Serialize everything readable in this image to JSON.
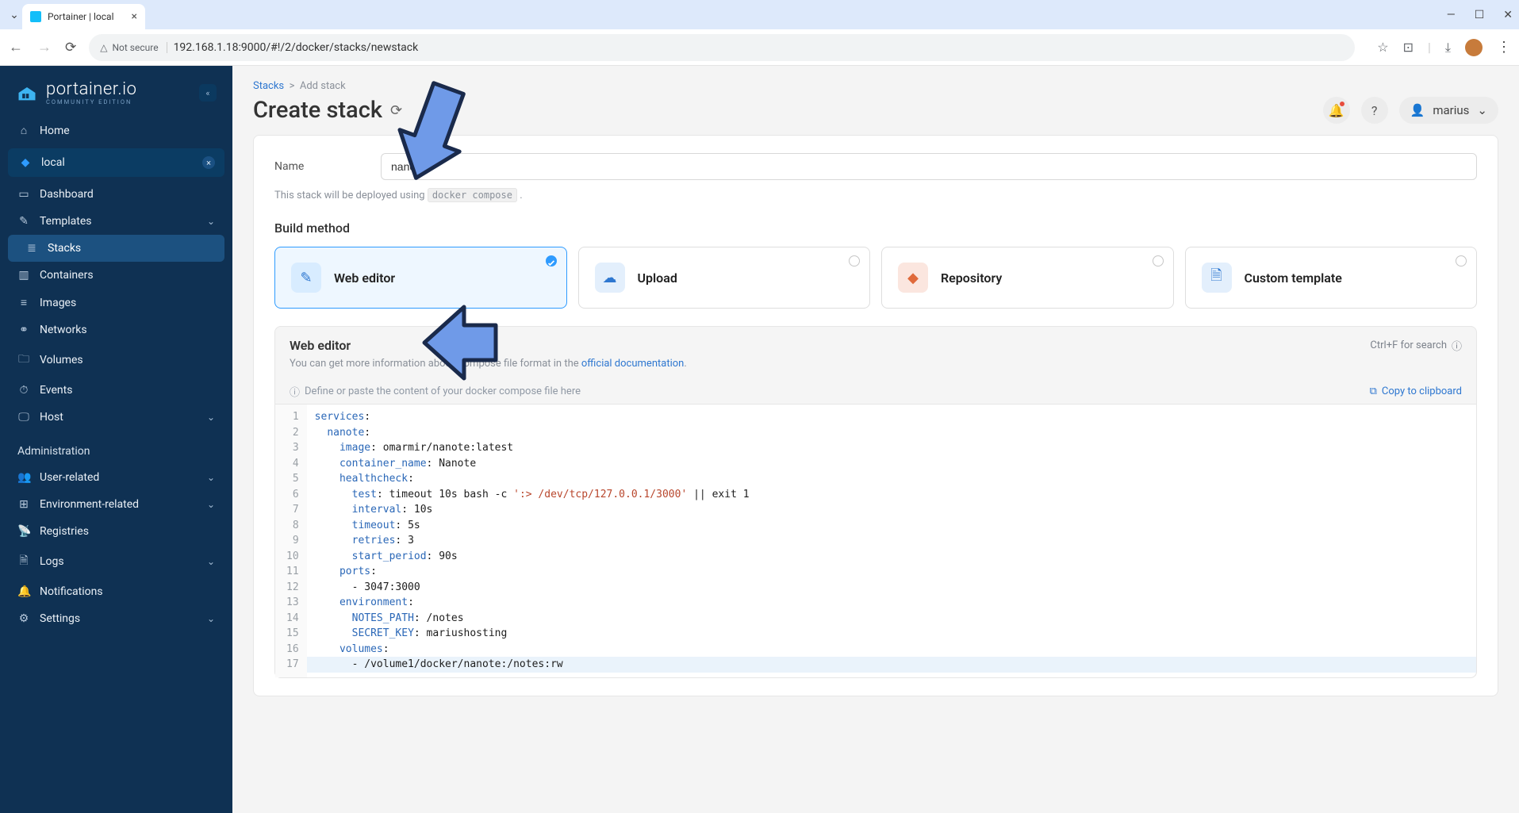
{
  "browser": {
    "tab_title": "Portainer | local",
    "url": "192.168.1.18:9000/#!/2/docker/stacks/newstack",
    "secure_label": "Not secure"
  },
  "brand": {
    "title": "portainer.io",
    "sub": "COMMUNITY EDITION"
  },
  "user": {
    "name": "marius"
  },
  "sidebar": {
    "home": "Home",
    "env_name": "local",
    "items": {
      "dashboard": "Dashboard",
      "templates": "Templates",
      "stacks": "Stacks",
      "containers": "Containers",
      "images": "Images",
      "networks": "Networks",
      "volumes": "Volumes",
      "events": "Events",
      "host": "Host"
    },
    "admin_title": "Administration",
    "admin": {
      "user_related": "User-related",
      "env_related": "Environment-related",
      "registries": "Registries",
      "logs": "Logs",
      "notifications": "Notifications",
      "settings": "Settings"
    }
  },
  "breadcrumb": {
    "root": "Stacks",
    "current": "Add stack"
  },
  "page": {
    "title": "Create stack",
    "name_label": "Name",
    "name_value": "nanote",
    "hint_prefix": "This stack will be deployed using ",
    "hint_code": "docker compose",
    "build_method_title": "Build method",
    "methods": {
      "web_editor": "Web editor",
      "upload": "Upload",
      "repository": "Repository",
      "custom_template": "Custom template"
    }
  },
  "editor": {
    "title": "Web editor",
    "search_hint": "Ctrl+F for search",
    "desc_prefix": "You can get more information about Compose file format in the ",
    "desc_link": "official documentation",
    "placeholder_hint": "Define or paste the content of your docker compose file here",
    "copy_label": "Copy to clipboard"
  },
  "code_lines": [
    {
      "n": 1,
      "segs": [
        {
          "t": "services",
          "c": "key"
        },
        {
          "t": ":",
          "c": "plain"
        }
      ]
    },
    {
      "n": 2,
      "segs": [
        {
          "t": "  ",
          "c": "plain"
        },
        {
          "t": "nanote",
          "c": "key"
        },
        {
          "t": ":",
          "c": "plain"
        }
      ]
    },
    {
      "n": 3,
      "segs": [
        {
          "t": "    ",
          "c": "plain"
        },
        {
          "t": "image",
          "c": "key"
        },
        {
          "t": ": omarmir/nanote:latest",
          "c": "plain"
        }
      ]
    },
    {
      "n": 4,
      "segs": [
        {
          "t": "    ",
          "c": "plain"
        },
        {
          "t": "container_name",
          "c": "key"
        },
        {
          "t": ": Nanote",
          "c": "plain"
        }
      ]
    },
    {
      "n": 5,
      "segs": [
        {
          "t": "    ",
          "c": "plain"
        },
        {
          "t": "healthcheck",
          "c": "key"
        },
        {
          "t": ":",
          "c": "plain"
        }
      ]
    },
    {
      "n": 6,
      "segs": [
        {
          "t": "      ",
          "c": "plain"
        },
        {
          "t": "test",
          "c": "key"
        },
        {
          "t": ": timeout 10s bash -c ",
          "c": "plain"
        },
        {
          "t": "':> /dev/tcp/127.0.0.1/3000'",
          "c": "str"
        },
        {
          "t": " || exit 1",
          "c": "plain"
        }
      ]
    },
    {
      "n": 7,
      "segs": [
        {
          "t": "      ",
          "c": "plain"
        },
        {
          "t": "interval",
          "c": "key"
        },
        {
          "t": ": 10s",
          "c": "plain"
        }
      ]
    },
    {
      "n": 8,
      "segs": [
        {
          "t": "      ",
          "c": "plain"
        },
        {
          "t": "timeout",
          "c": "key"
        },
        {
          "t": ": 5s",
          "c": "plain"
        }
      ]
    },
    {
      "n": 9,
      "segs": [
        {
          "t": "      ",
          "c": "plain"
        },
        {
          "t": "retries",
          "c": "key"
        },
        {
          "t": ": 3",
          "c": "plain"
        }
      ]
    },
    {
      "n": 10,
      "segs": [
        {
          "t": "      ",
          "c": "plain"
        },
        {
          "t": "start_period",
          "c": "key"
        },
        {
          "t": ": 90s",
          "c": "plain"
        }
      ]
    },
    {
      "n": 11,
      "segs": [
        {
          "t": "    ",
          "c": "plain"
        },
        {
          "t": "ports",
          "c": "key"
        },
        {
          "t": ":",
          "c": "plain"
        }
      ]
    },
    {
      "n": 12,
      "segs": [
        {
          "t": "      - 3047:3000",
          "c": "plain"
        }
      ]
    },
    {
      "n": 13,
      "segs": [
        {
          "t": "    ",
          "c": "plain"
        },
        {
          "t": "environment",
          "c": "key"
        },
        {
          "t": ":",
          "c": "plain"
        }
      ]
    },
    {
      "n": 14,
      "segs": [
        {
          "t": "      ",
          "c": "plain"
        },
        {
          "t": "NOTES_PATH",
          "c": "key"
        },
        {
          "t": ": /notes",
          "c": "plain"
        }
      ]
    },
    {
      "n": 15,
      "segs": [
        {
          "t": "      ",
          "c": "plain"
        },
        {
          "t": "SECRET_KEY",
          "c": "key"
        },
        {
          "t": ": mariushosting",
          "c": "plain"
        }
      ]
    },
    {
      "n": 16,
      "segs": [
        {
          "t": "    ",
          "c": "plain"
        },
        {
          "t": "volumes",
          "c": "key"
        },
        {
          "t": ":",
          "c": "plain"
        }
      ]
    },
    {
      "n": 17,
      "segs": [
        {
          "t": "      - /volume1/docker/nanote:/notes:rw",
          "c": "plain"
        }
      ],
      "current": true
    }
  ]
}
